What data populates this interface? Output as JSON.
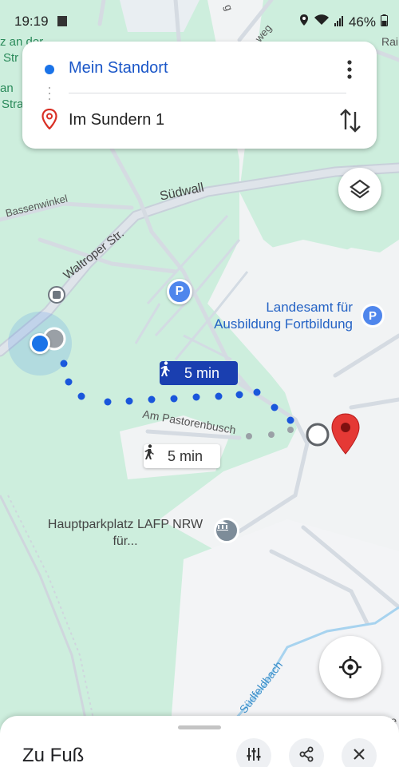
{
  "status_bar": {
    "time": "19:19",
    "battery": "46%"
  },
  "route": {
    "origin": "Mein Standort",
    "destination": "Im Sundern 1"
  },
  "map": {
    "streets": {
      "suedwall": "Südwall",
      "waltroper": "Waltroper Str.",
      "bassenwinkel": "Bassenwinkel",
      "pastorenbusch": "Am Pastorenbusch",
      "suedfeldbach": "Südfeldbach"
    },
    "edge_fragments": {
      "top_left_1": "z an der",
      "top_left_2": "Str",
      "top_left_3": "an",
      "top_left_4": "Stra",
      "top_right": "Rai",
      "bottom_right": "Se",
      "top_road": "weg",
      "top_road2": "g"
    },
    "pois": {
      "landesamt_line1": "Landesamt für",
      "landesamt_line2": "Ausbildung Fortbildung",
      "parking_letter": "P",
      "parking_letter_2": "P",
      "hauptparkplatz_line1": "Hauptparkplatz LAFP NRW",
      "hauptparkplatz_line2": "für..."
    },
    "eta_primary": "5 min",
    "eta_secondary": "5 min",
    "colors": {
      "route": "#1a56db",
      "greenery": "#cdeedd",
      "road": "#d6dde5",
      "pin": "#e53935"
    }
  },
  "sheet": {
    "title": "Zu Fuß"
  },
  "icons": [
    "wifi-icon",
    "signal-icon",
    "battery-icon",
    "location-icon",
    "more-vert-icon",
    "swap-icon",
    "layers-icon",
    "my-location-icon",
    "walk-icon",
    "tune-icon",
    "share-icon",
    "close-icon",
    "pin-icon",
    "parking-icon",
    "bus-stop-icon",
    "museum-icon"
  ]
}
